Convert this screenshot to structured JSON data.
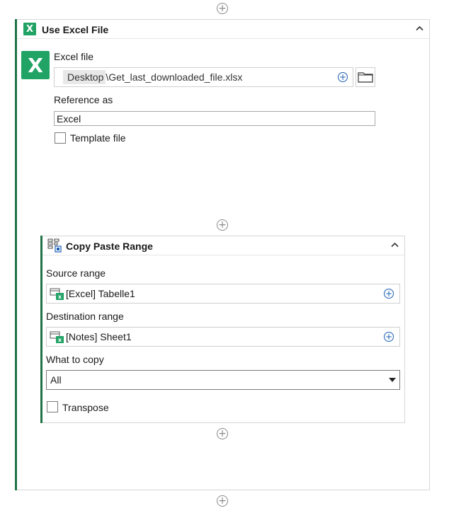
{
  "use_excel_file": {
    "title": "Use Excel File",
    "excel_file_label": "Excel file",
    "excel_file_path_folder": "Desktop",
    "excel_file_path_rest": "\\Get_last_downloaded_file.xlsx",
    "reference_label": "Reference as",
    "reference_value": "Excel",
    "template_label": "Template file",
    "template_checked": false
  },
  "copy_paste_range": {
    "title": "Copy Paste Range",
    "source_label": "Source range",
    "source_value": "[Excel] Tabelle1",
    "destination_label": "Destination range",
    "destination_value": "[Notes] Sheet1",
    "what_label": "What to copy",
    "what_value": "All",
    "transpose_label": "Transpose",
    "transpose_checked": false
  },
  "icons": {
    "excel": "X",
    "add": "+",
    "collapse": "chevron-up-icon",
    "dropdown": "caret-down-icon",
    "folder": "folder-icon"
  },
  "colors": {
    "excel_green": "#21a366",
    "accent_green": "#217346",
    "link_blue": "#1a5fb4"
  }
}
